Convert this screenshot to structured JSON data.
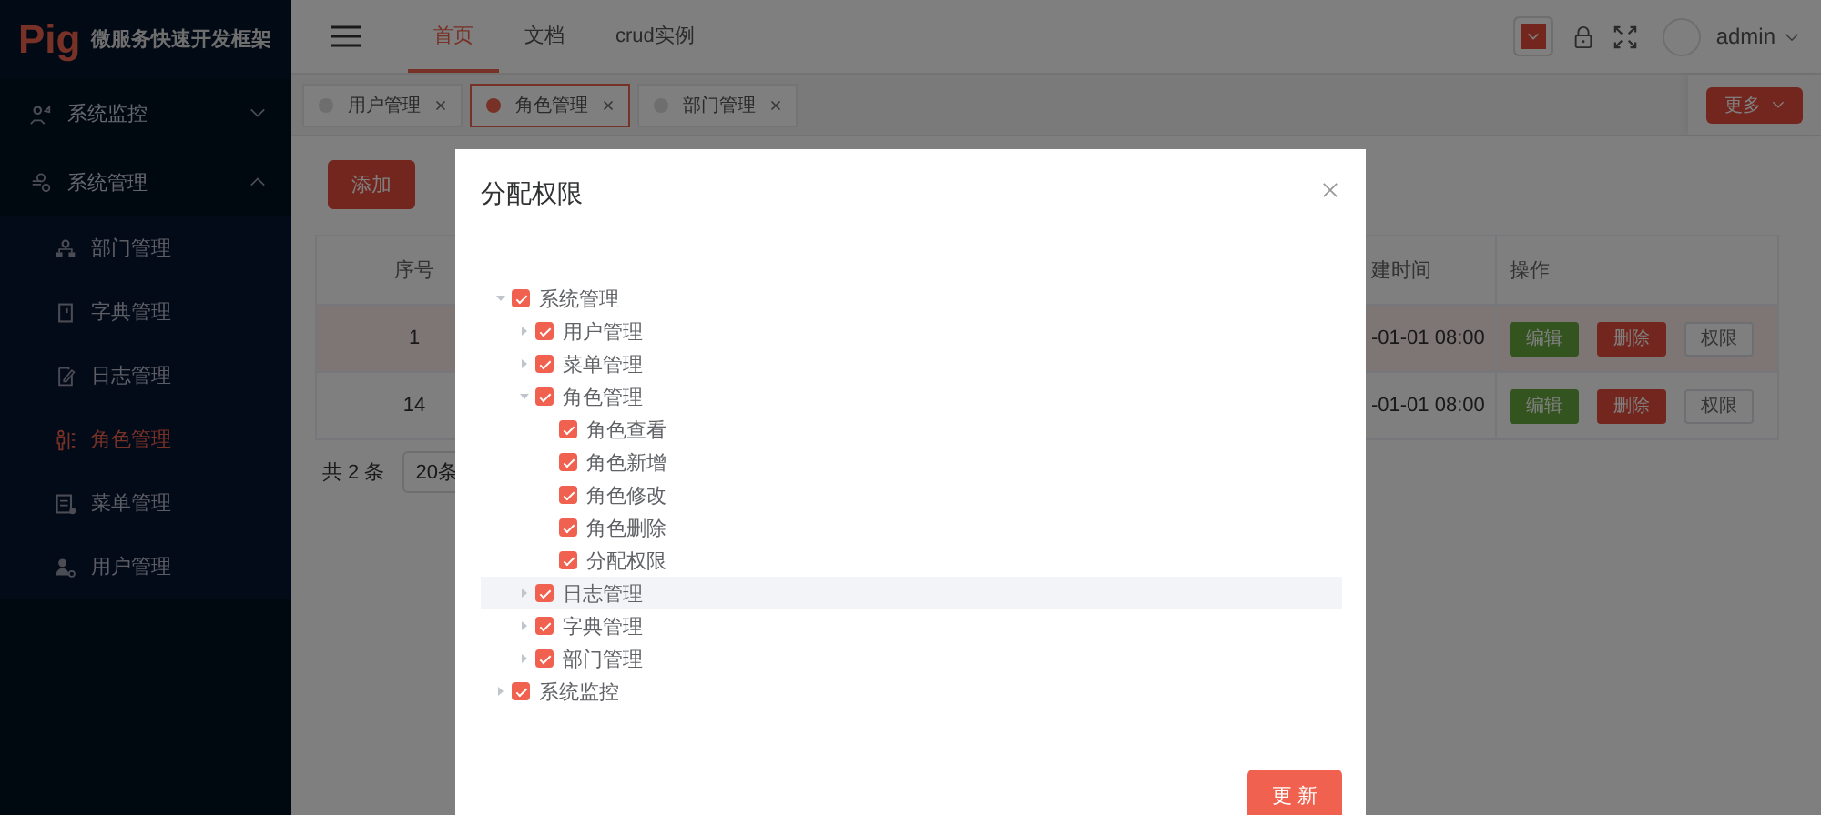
{
  "sidebar": {
    "logo": "Pig",
    "title": "微服务快速开发框架",
    "menu": [
      {
        "label": "系统监控",
        "expanded": false
      },
      {
        "label": "系统管理",
        "expanded": true,
        "children": [
          {
            "label": "部门管理",
            "selected": false
          },
          {
            "label": "字典管理",
            "selected": false
          },
          {
            "label": "日志管理",
            "selected": false
          },
          {
            "label": "角色管理",
            "selected": true
          },
          {
            "label": "菜单管理",
            "selected": false
          },
          {
            "label": "用户管理",
            "selected": false
          }
        ]
      }
    ]
  },
  "header": {
    "nav": [
      {
        "label": "首页",
        "selected": true
      },
      {
        "label": "文档",
        "selected": false
      },
      {
        "label": "crud实例",
        "selected": false
      }
    ],
    "user": "admin"
  },
  "tags": [
    {
      "label": "用户管理",
      "selected": false
    },
    {
      "label": "角色管理",
      "selected": true
    },
    {
      "label": "部门管理",
      "selected": false
    }
  ],
  "more_button": "更多",
  "content": {
    "add_button": "添加",
    "table": {
      "columns": [
        "序号",
        "建时间",
        "操作"
      ],
      "rows": [
        {
          "cells": [
            "1",
            "-01-01 08:00"
          ],
          "selected": true,
          "actions": [
            "编辑",
            "删除",
            "权限"
          ]
        },
        {
          "cells": [
            "14",
            "-01-01 08:00"
          ],
          "selected": false,
          "actions": [
            "编辑",
            "删除",
            "权限"
          ]
        }
      ]
    },
    "pagination": {
      "total": "共 2 条",
      "page_size": "20条"
    }
  },
  "dialog": {
    "title": "分配权限",
    "tree": [
      {
        "label": "系统管理",
        "checked": true,
        "expanded": true,
        "selected": false,
        "children": [
          {
            "label": "用户管理",
            "checked": true,
            "expanded": false,
            "selected": false
          },
          {
            "label": "菜单管理",
            "checked": true,
            "expanded": false,
            "selected": false
          },
          {
            "label": "角色管理",
            "checked": true,
            "expanded": true,
            "selected": false,
            "children": [
              {
                "label": "角色查看",
                "checked": true,
                "selected": false
              },
              {
                "label": "角色新增",
                "checked": true,
                "selected": false
              },
              {
                "label": "角色修改",
                "checked": true,
                "selected": false
              },
              {
                "label": "角色删除",
                "checked": true,
                "selected": false
              },
              {
                "label": "分配权限",
                "checked": true,
                "selected": false
              }
            ]
          },
          {
            "label": "日志管理",
            "checked": true,
            "expanded": false,
            "selected": true
          },
          {
            "label": "字典管理",
            "checked": true,
            "expanded": false,
            "selected": false
          },
          {
            "label": "部门管理",
            "checked": true,
            "expanded": false,
            "selected": false
          }
        ]
      },
      {
        "label": "系统监控",
        "checked": true,
        "expanded": false,
        "selected": false
      }
    ],
    "submit_button": "更 新"
  }
}
